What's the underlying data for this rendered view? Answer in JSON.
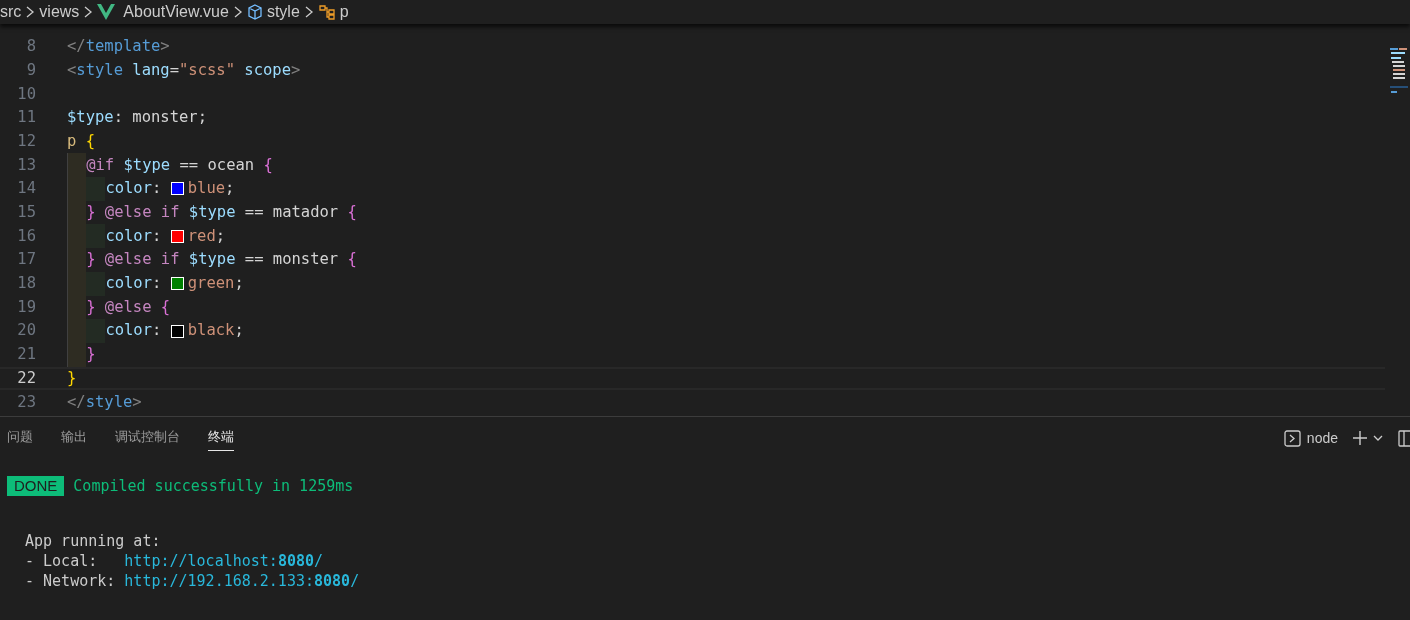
{
  "breadcrumb": [
    {
      "kind": "folder",
      "label": "src"
    },
    {
      "kind": "folder",
      "label": "views"
    },
    {
      "kind": "vue",
      "label": "AboutView.vue"
    },
    {
      "kind": "module",
      "label": "style"
    },
    {
      "kind": "selector",
      "label": "p"
    }
  ],
  "code_lines": [
    {
      "number": "8",
      "current": false,
      "tokens": [
        {
          "kind": "punct",
          "text": "</"
        },
        {
          "kind": "tag",
          "text": "template"
        },
        {
          "kind": "punct",
          "text": ">"
        }
      ]
    },
    {
      "number": "9",
      "current": false,
      "tokens": [
        {
          "kind": "punct",
          "text": "<"
        },
        {
          "kind": "tag",
          "text": "style"
        },
        {
          "kind": "attr",
          "text": " lang"
        },
        {
          "kind": "plain",
          "text": "="
        },
        {
          "kind": "string",
          "text": "\"scss\""
        },
        {
          "kind": "attr",
          "text": " scope"
        },
        {
          "kind": "punct",
          "text": ">"
        }
      ]
    },
    {
      "number": "10",
      "current": false
    },
    {
      "number": "11",
      "current": false,
      "tokens": [
        {
          "kind": "attr",
          "text": "$type"
        },
        {
          "kind": "plain",
          "text": ": monster;"
        }
      ]
    },
    {
      "number": "12",
      "current": false,
      "tokens": [
        {
          "kind": "selector",
          "text": "p "
        },
        {
          "kind": "brace1",
          "text": "{"
        }
      ],
      "children": [
        {
          "number": "13",
          "current": false,
          "tokens": [
            {
              "kind": "keyword",
              "text": "@if"
            },
            {
              "kind": "attr",
              "text": " $type"
            },
            {
              "kind": "plain",
              "text": " == ocean "
            },
            {
              "kind": "brace2",
              "text": "{"
            }
          ],
          "children": [
            {
              "number": "14",
              "current": false,
              "tokens": [
                {
                  "kind": "attr",
                  "text": "color"
                },
                {
                  "kind": "plain",
                  "text": ": "
                },
                {
                  "kind": "swatch",
                  "color": "#0000ff"
                },
                {
                  "kind": "string",
                  "text": "blue"
                },
                {
                  "kind": "plain",
                  "text": ";"
                }
              ]
            }
          ]
        },
        {
          "number": "15",
          "current": false,
          "tokens": [
            {
              "kind": "brace2",
              "text": "}"
            },
            {
              "kind": "keyword",
              "text": " @else if"
            },
            {
              "kind": "attr",
              "text": " $type"
            },
            {
              "kind": "plain",
              "text": " == matador "
            },
            {
              "kind": "brace2",
              "text": "{"
            }
          ],
          "children": [
            {
              "number": "16",
              "current": false,
              "tokens": [
                {
                  "kind": "attr",
                  "text": "color"
                },
                {
                  "kind": "plain",
                  "text": ": "
                },
                {
                  "kind": "swatch",
                  "color": "#ff0000"
                },
                {
                  "kind": "string",
                  "text": "red"
                },
                {
                  "kind": "plain",
                  "text": ";"
                }
              ]
            }
          ]
        },
        {
          "number": "17",
          "current": false,
          "tokens": [
            {
              "kind": "brace2",
              "text": "}"
            },
            {
              "kind": "keyword",
              "text": " @else if"
            },
            {
              "kind": "attr",
              "text": " $type"
            },
            {
              "kind": "plain",
              "text": " == monster "
            },
            {
              "kind": "brace2",
              "text": "{"
            }
          ],
          "children": [
            {
              "number": "18",
              "current": false,
              "tokens": [
                {
                  "kind": "attr",
                  "text": "color"
                },
                {
                  "kind": "plain",
                  "text": ": "
                },
                {
                  "kind": "swatch",
                  "color": "#008000"
                },
                {
                  "kind": "string",
                  "text": "green"
                },
                {
                  "kind": "plain",
                  "text": ";"
                }
              ]
            }
          ]
        },
        {
          "number": "19",
          "current": false,
          "tokens": [
            {
              "kind": "brace2",
              "text": "}"
            },
            {
              "kind": "keyword",
              "text": " @else "
            },
            {
              "kind": "brace2",
              "text": "{"
            }
          ],
          "children": [
            {
              "number": "20",
              "current": false,
              "tokens": [
                {
                  "kind": "attr",
                  "text": "color"
                },
                {
                  "kind": "plain",
                  "text": ": "
                },
                {
                  "kind": "swatch",
                  "color": "#000000"
                },
                {
                  "kind": "string",
                  "text": "black"
                },
                {
                  "kind": "plain",
                  "text": ";"
                }
              ]
            }
          ]
        },
        {
          "number": "21",
          "current": false,
          "tokens": [
            {
              "kind": "brace2",
              "text": "}"
            }
          ]
        }
      ]
    },
    {
      "number": "22",
      "current": true,
      "tokens": [
        {
          "kind": "brace1",
          "text": "}"
        }
      ]
    },
    {
      "number": "23",
      "current": false,
      "tokens": [
        {
          "kind": "punct",
          "text": "</"
        },
        {
          "kind": "tag",
          "text": "style"
        },
        {
          "kind": "punct",
          "text": ">"
        }
      ]
    }
  ],
  "panel_tabs": [
    {
      "label": "问题",
      "selected": false
    },
    {
      "label": "输出",
      "selected": false
    },
    {
      "label": "调试控制台",
      "selected": false
    },
    {
      "label": "终端",
      "selected": true
    }
  ],
  "terminal_label": "node",
  "terminal": {
    "badge": "DONE",
    "message": "Compiled successfully in 1259ms",
    "heading": "App running at:",
    "urls": [
      {
        "label": "- Local:   ",
        "prefix": "http://localhost:",
        "port": "8080",
        "suffix": "/"
      },
      {
        "label": "- Network: ",
        "prefix": "http://192.168.2.133:",
        "port": "8080",
        "suffix": "/"
      }
    ]
  }
}
